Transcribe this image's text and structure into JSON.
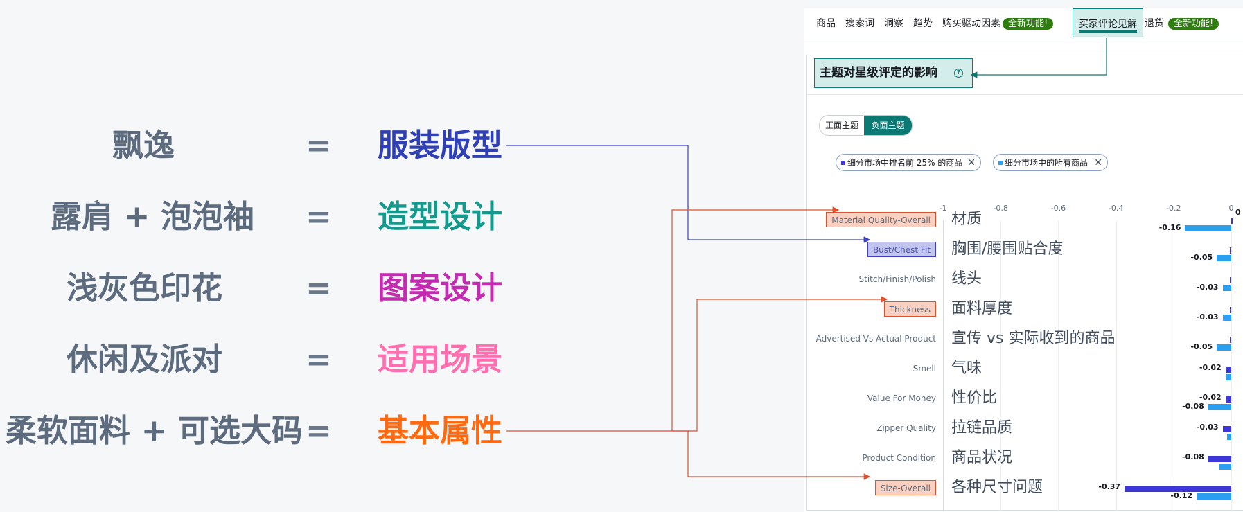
{
  "equations": [
    {
      "left": "飘逸",
      "sign": "=",
      "right": "服装版型",
      "color": "#2f3fb5"
    },
    {
      "left": "露肩 + 泡泡袖",
      "sign": "=",
      "right": "造型设计",
      "color": "#149a8c"
    },
    {
      "left": "浅灰色印花",
      "sign": "=",
      "right": "图案设计",
      "color": "#c42bb0"
    },
    {
      "left": "休闲及派对",
      "sign": "=",
      "right": "适用场景",
      "color": "#ff6fb0"
    },
    {
      "left": "柔软面料 + 可选大码",
      "sign": "=",
      "right": "基本属性",
      "color": "#ff6a10"
    }
  ],
  "tabs": {
    "items": [
      "商品",
      "搜索词",
      "洞察",
      "趋势",
      "购买驱动因素"
    ],
    "new_badge": "全新功能!",
    "active": "买家评论见解",
    "returns": "退货",
    "new_badge2": "全新功能!"
  },
  "card": {
    "title": "主题对星级评定的影响",
    "help_icon": "?",
    "toggle_positive": "正面主题",
    "toggle_negative": "负面主题",
    "chip_top": "细分市场中排名前 25% 的商品",
    "chip_all": "细分市场中的所有商品",
    "chip_close": "✕"
  },
  "colors": {
    "top25": "#3d37d8",
    "all": "#2a9ff0",
    "accent": "#0b7a75",
    "highlight_orange": "#e0502a",
    "highlight_blue": "#3d3ec7"
  },
  "chart_data": {
    "type": "bar",
    "orientation": "horizontal",
    "title": "主题对星级评定的影响",
    "xlim": [
      -1,
      0
    ],
    "xticks": [
      "-1",
      "-0.8",
      "-0.6",
      "-0.4",
      "-0.2",
      "0"
    ],
    "categories": [
      {
        "en": "Material Quality-Overall",
        "zh": "材质",
        "highlight": "orange"
      },
      {
        "en": "Bust/Chest Fit",
        "zh": "胸围/腰围贴合度",
        "highlight": "blue"
      },
      {
        "en": "Stitch/Finish/Polish",
        "zh": "线头",
        "highlight": "none"
      },
      {
        "en": "Thickness",
        "zh": "面料厚度",
        "highlight": "orange"
      },
      {
        "en": "Advertised Vs Actual Product",
        "zh": "宣传 vs 实际收到的商品",
        "highlight": "none"
      },
      {
        "en": "Smell",
        "zh": "气味",
        "highlight": "none"
      },
      {
        "en": "Value For Money",
        "zh": "性价比",
        "highlight": "none"
      },
      {
        "en": "Zipper Quality",
        "zh": "拉链品质",
        "highlight": "none"
      },
      {
        "en": "Product Condition",
        "zh": "商品状况",
        "highlight": "none"
      },
      {
        "en": "Size-Overall",
        "zh": "各种尺寸问题",
        "highlight": "orange"
      }
    ],
    "series": [
      {
        "name": "细分市场中排名前 25% 的商品",
        "values": [
          0,
          -0.005,
          -0.005,
          -0.005,
          -0.005,
          -0.02,
          -0.02,
          -0.03,
          -0.08,
          -0.37
        ],
        "labels": [
          "0",
          "",
          "",
          "",
          "",
          "-0.02",
          "-0.02",
          "-0.03",
          "-0.08",
          "-0.37"
        ]
      },
      {
        "name": "细分市场中的所有商品",
        "values": [
          -0.16,
          -0.05,
          -0.03,
          -0.03,
          -0.05,
          -0.02,
          -0.08,
          -0.015,
          -0.04,
          -0.12
        ],
        "labels": [
          "-0.16",
          "-0.05",
          "-0.03",
          "-0.03",
          "-0.05",
          "",
          "-0.08",
          "",
          "",
          "-0.12"
        ]
      }
    ]
  }
}
